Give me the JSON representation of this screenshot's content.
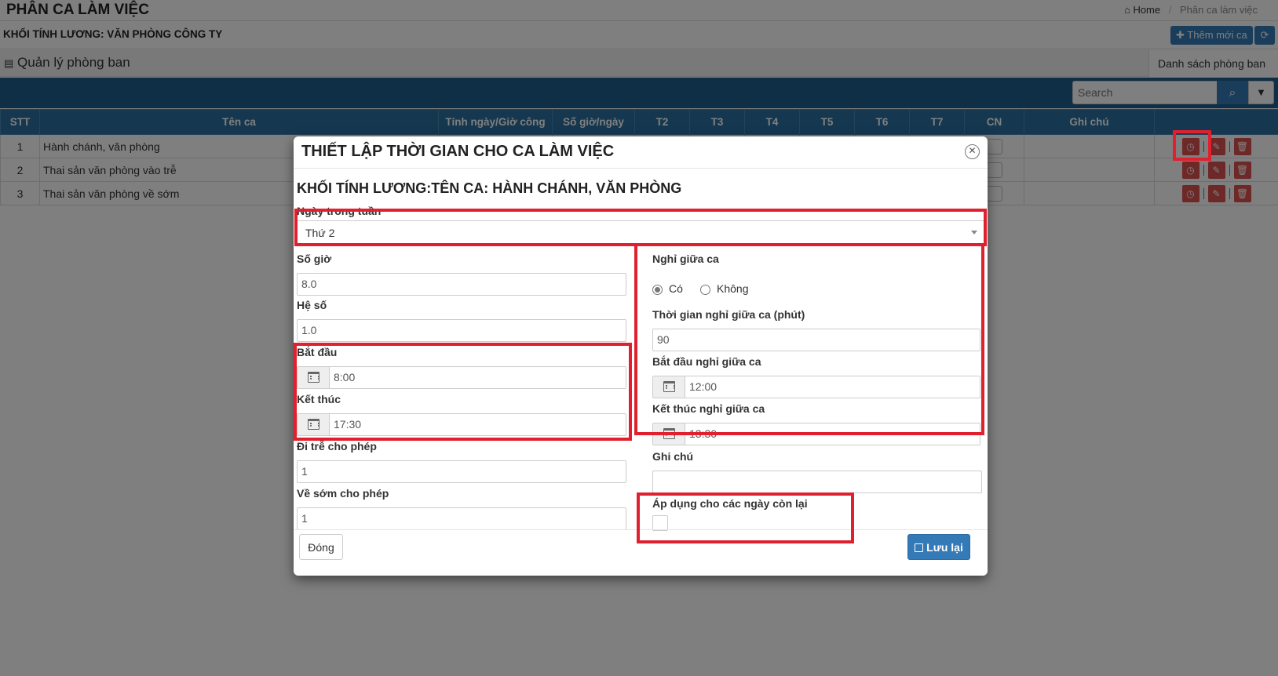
{
  "page": {
    "title": "PHÂN CA LÀM VIỆC",
    "breadcrumb": {
      "home": "Home",
      "separator": "/",
      "current": "Phân ca làm việc"
    },
    "subtitle": "KHỐI TÍNH LƯƠNG: VĂN PHÒNG CÔNG TY",
    "add_shift_button": "Thêm mới ca",
    "dept_title": "Quản lý phòng ban",
    "dept_tab": "Danh sách phòng ban",
    "search_placeholder": "Search"
  },
  "table": {
    "columns": [
      "STT",
      "Tên ca",
      "Tính ngày/Giờ công",
      "Số giờ/ngày",
      "T2",
      "T3",
      "T4",
      "T5",
      "T6",
      "T7",
      "CN",
      "Ghi chú"
    ],
    "rows": [
      {
        "stt": "1",
        "name": "Hành chánh, văn phòng"
      },
      {
        "stt": "2",
        "name": "Thai sản văn phòng vào trễ"
      },
      {
        "stt": "3",
        "name": "Thai sản văn phòng về sớm"
      }
    ]
  },
  "modal": {
    "title": "THIẾT LẬP THỜI GIAN CHO CA LÀM VIỆC",
    "subtitle": "KHỐI TÍNH LƯƠNG:TÊN CA: HÀNH CHÁNH, VĂN PHÒNG",
    "day_label": "Ngày trong tuần",
    "day_value": "Thứ 2",
    "hours_label": "Số giờ",
    "hours_value": "8.0",
    "coef_label": "Hệ số",
    "coef_value": "1.0",
    "start_label": "Bắt đầu",
    "start_value": "8:00",
    "end_label": "Kết thúc",
    "end_value": "17:30",
    "late_label": "Đi trễ cho phép",
    "late_value": "1",
    "early_label": "Về sớm cho phép",
    "early_value": "1",
    "break_label": "Nghỉ giữa ca",
    "break_yes": "Có",
    "break_no": "Không",
    "break_selected": "Có",
    "break_duration_label": "Thời gian nghỉ giữa ca (phút)",
    "break_duration_value": "90",
    "break_start_label": "Bắt đầu nghỉ giữa ca",
    "break_start_value": "12:00",
    "break_end_label": "Kết thúc nghỉ giữa ca",
    "break_end_value": "13:30",
    "note_label": "Ghi chú",
    "note_value": "",
    "apply_label": "Áp dụng cho các ngày còn lại",
    "close_button": "Đóng",
    "save_button": "Lưu lại"
  },
  "colors": {
    "primary": "#337ab7",
    "header_bg": "#1e5f8d",
    "danger": "#d9534f",
    "highlight": "#e0202e"
  },
  "icons": [
    "home-icon",
    "plus-icon",
    "refresh-icon",
    "inbox-icon",
    "search-icon",
    "caret-down-icon",
    "clock-icon",
    "pencil-icon",
    "trash-icon",
    "close-circle-icon",
    "calendar-icon",
    "save-icon"
  ]
}
